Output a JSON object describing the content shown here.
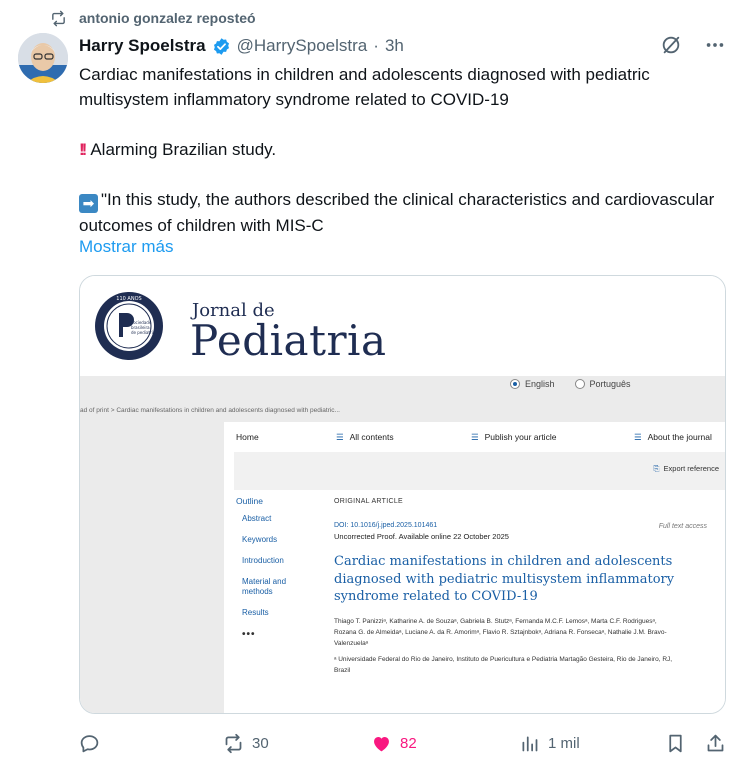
{
  "repost": {
    "text": "antonio gonzalez reposteó"
  },
  "author": {
    "name": "Harry Spoelstra",
    "handle": "@HarrySpoelstra",
    "separator": "·",
    "time": "3h"
  },
  "tweet": {
    "line1": "Cardiac manifestations in children and adolescents diagnosed with pediatric multisystem inflammatory syndrome related to COVID-19",
    "bang": "‼️",
    "line2": "Alarming Brazilian study.",
    "arrow": "➡",
    "line3": "\"In this study, the authors described the clinical characteristics and cardiovascular outcomes of children with MIS-C",
    "show_more": "Mostrar más"
  },
  "card": {
    "journal_de": "Jornal de",
    "journal_name": "Pediatria",
    "seal_text_top": "+ 110 ANOS +",
    "seal_center_1": "sociedade",
    "seal_center_2": "brasileira",
    "seal_center_3": "de pediatria",
    "lang_en": "English",
    "lang_pt": "Português",
    "breadcrumb": "ad of print > Cardiac manifestations in children and adolescents diagnosed with pediatric...",
    "nav": {
      "home": "Home",
      "all": "All contents",
      "publish": "Publish your article",
      "about": "About the journal"
    },
    "export": "Export reference",
    "outline": {
      "title": "Outline",
      "items": [
        "Abstract",
        "Keywords",
        "Introduction",
        "Material and methods",
        "Results"
      ],
      "more": "•••"
    },
    "article": {
      "type": "ORIGINAL ARTICLE",
      "doi": "DOI: 10.1016/j.jped.2025.101461",
      "full_text": "Full text access",
      "proof": "Uncorrected Proof. Available online 22 October 2025",
      "title": "Cardiac manifestations in children and adolescents diagnosed with pediatric multisystem inflammatory syndrome related to COVID-19",
      "authors": "Thiago T. Panizziᵃ, Katharine A. de Souzaᵃ, Gabriela B. Stutzᵃ, Fernanda M.C.F. Lemosᵃ, Marta C.F. Rodriguesᵃ, Rozana G. de Almeidaᵃ, Luciane A. da R. Amorimᵃ, Flavio R. Sztajnbokᵃ, Adriana R. Fonsecaᵃ, Nathalie J.M. Bravo-Valenzuelaᵃ",
      "affiliation": "ᵃ Universidade Federal do Rio de Janeiro, Instituto de Puericultura e Pediatria Martagão Gesteira, Rio de Janeiro, RJ, Brazil"
    }
  },
  "actions": {
    "replies": "",
    "reposts": "30",
    "likes": "82",
    "views": "1 mil"
  },
  "colors": {
    "accent": "#1d9bf0",
    "like": "#f91880",
    "muted": "#536471",
    "journal": "#1f2d52"
  }
}
